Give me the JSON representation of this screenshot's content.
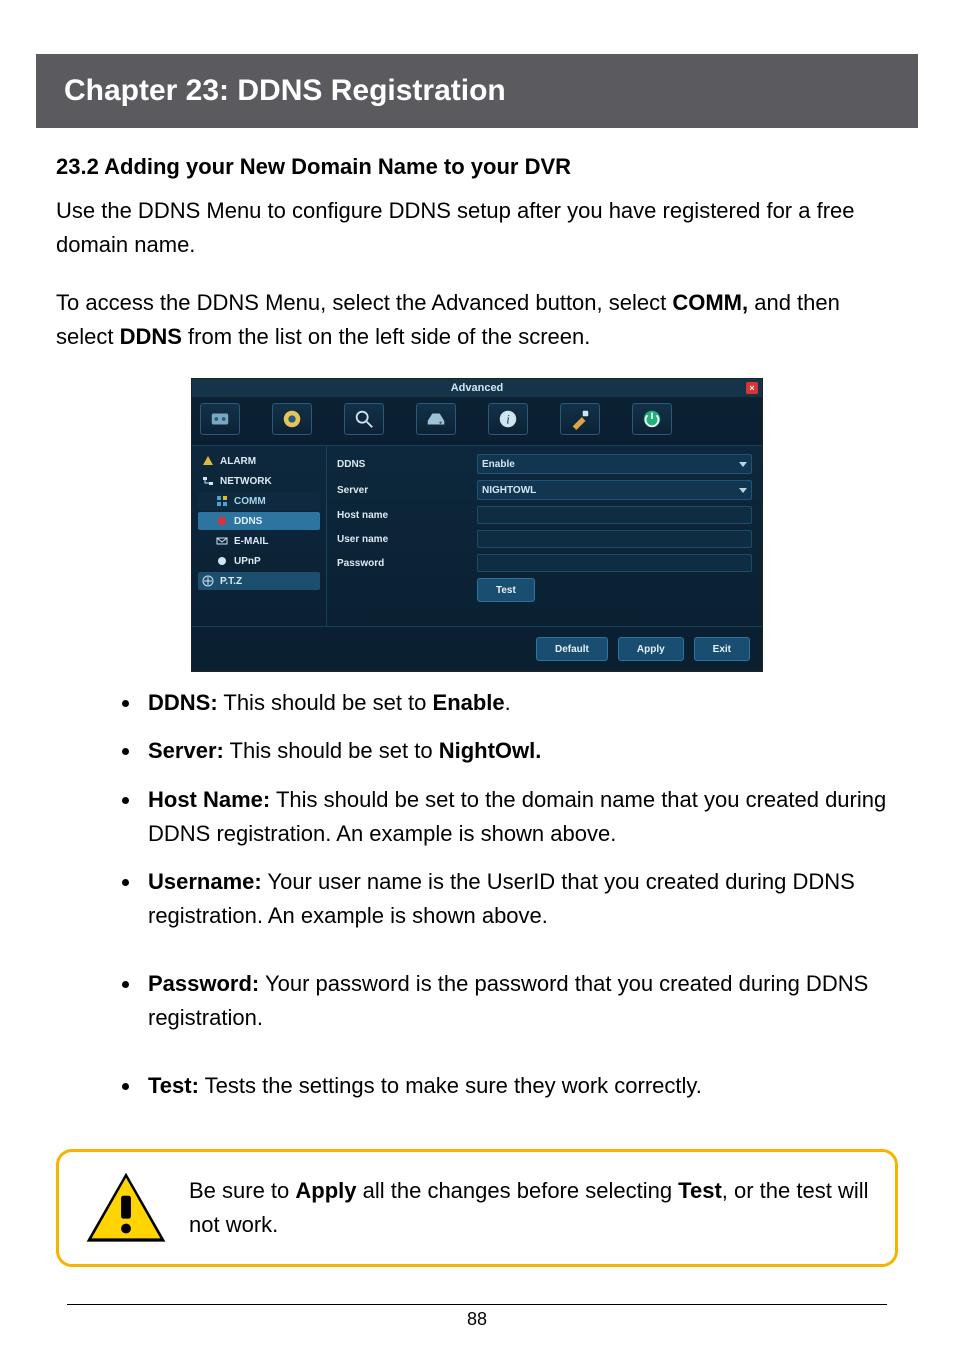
{
  "chapter": {
    "title": "Chapter 23: DDNS Registration"
  },
  "section": {
    "heading": "23.2 Adding your New Domain Name to your DVR"
  },
  "intro1": "Use the DDNS Menu to configure DDNS setup after you have registered for a free domain name.",
  "intro2a": "To access the DDNS Menu, select the Advanced button, select ",
  "intro2b": "COMM,",
  "intro3a": " and then select ",
  "intro3b": "DDNS",
  "intro3c": " from the list on the left side of the screen.",
  "screenshot": {
    "title": "Advanced",
    "side": {
      "alarm": "ALARM",
      "network": "NETWORK",
      "comm": "COMM",
      "ddns": "DDNS",
      "email": "E-MAIL",
      "upnp": "UPnP",
      "ptz": "P.T.Z"
    },
    "form": {
      "ddns_label": "DDNS",
      "ddns_value": "Enable",
      "server_label": "Server",
      "server_value": "NIGHTOWL",
      "hostname_label": "Host name",
      "username_label": "User name",
      "password_label": "Password",
      "test": "Test"
    },
    "footer": {
      "default": "Default",
      "apply": "Apply",
      "exit": "Exit"
    }
  },
  "bullets": {
    "b1_label": "DDNS:",
    "b1_text": " This should be set to ",
    "b1_val": "Enable",
    "b1_end": ".",
    "b2_label": "Server:",
    "b2_text": " This should be set to ",
    "b2_val": "NightOwl.",
    "b3_label": "Host Name:",
    "b3_text": " This should be set to the domain name that you created during DDNS registration. An example is shown above.",
    "b4_label": "Username:",
    "b4_text": " Your user name is the UserID that you created during DDNS registration. An example is shown above.",
    "b5_label": "Password:",
    "b5_text": " Your password is the password that you created during DDNS registration.",
    "b6_label": "Test:",
    "b6_text": " Tests the settings to make sure they work correctly."
  },
  "callout": {
    "pre": "Be sure to ",
    "apply": "Apply",
    "mid": " all the changes before selecting ",
    "test": "Test",
    "post": ", or the test will not work."
  },
  "page_number": "88"
}
